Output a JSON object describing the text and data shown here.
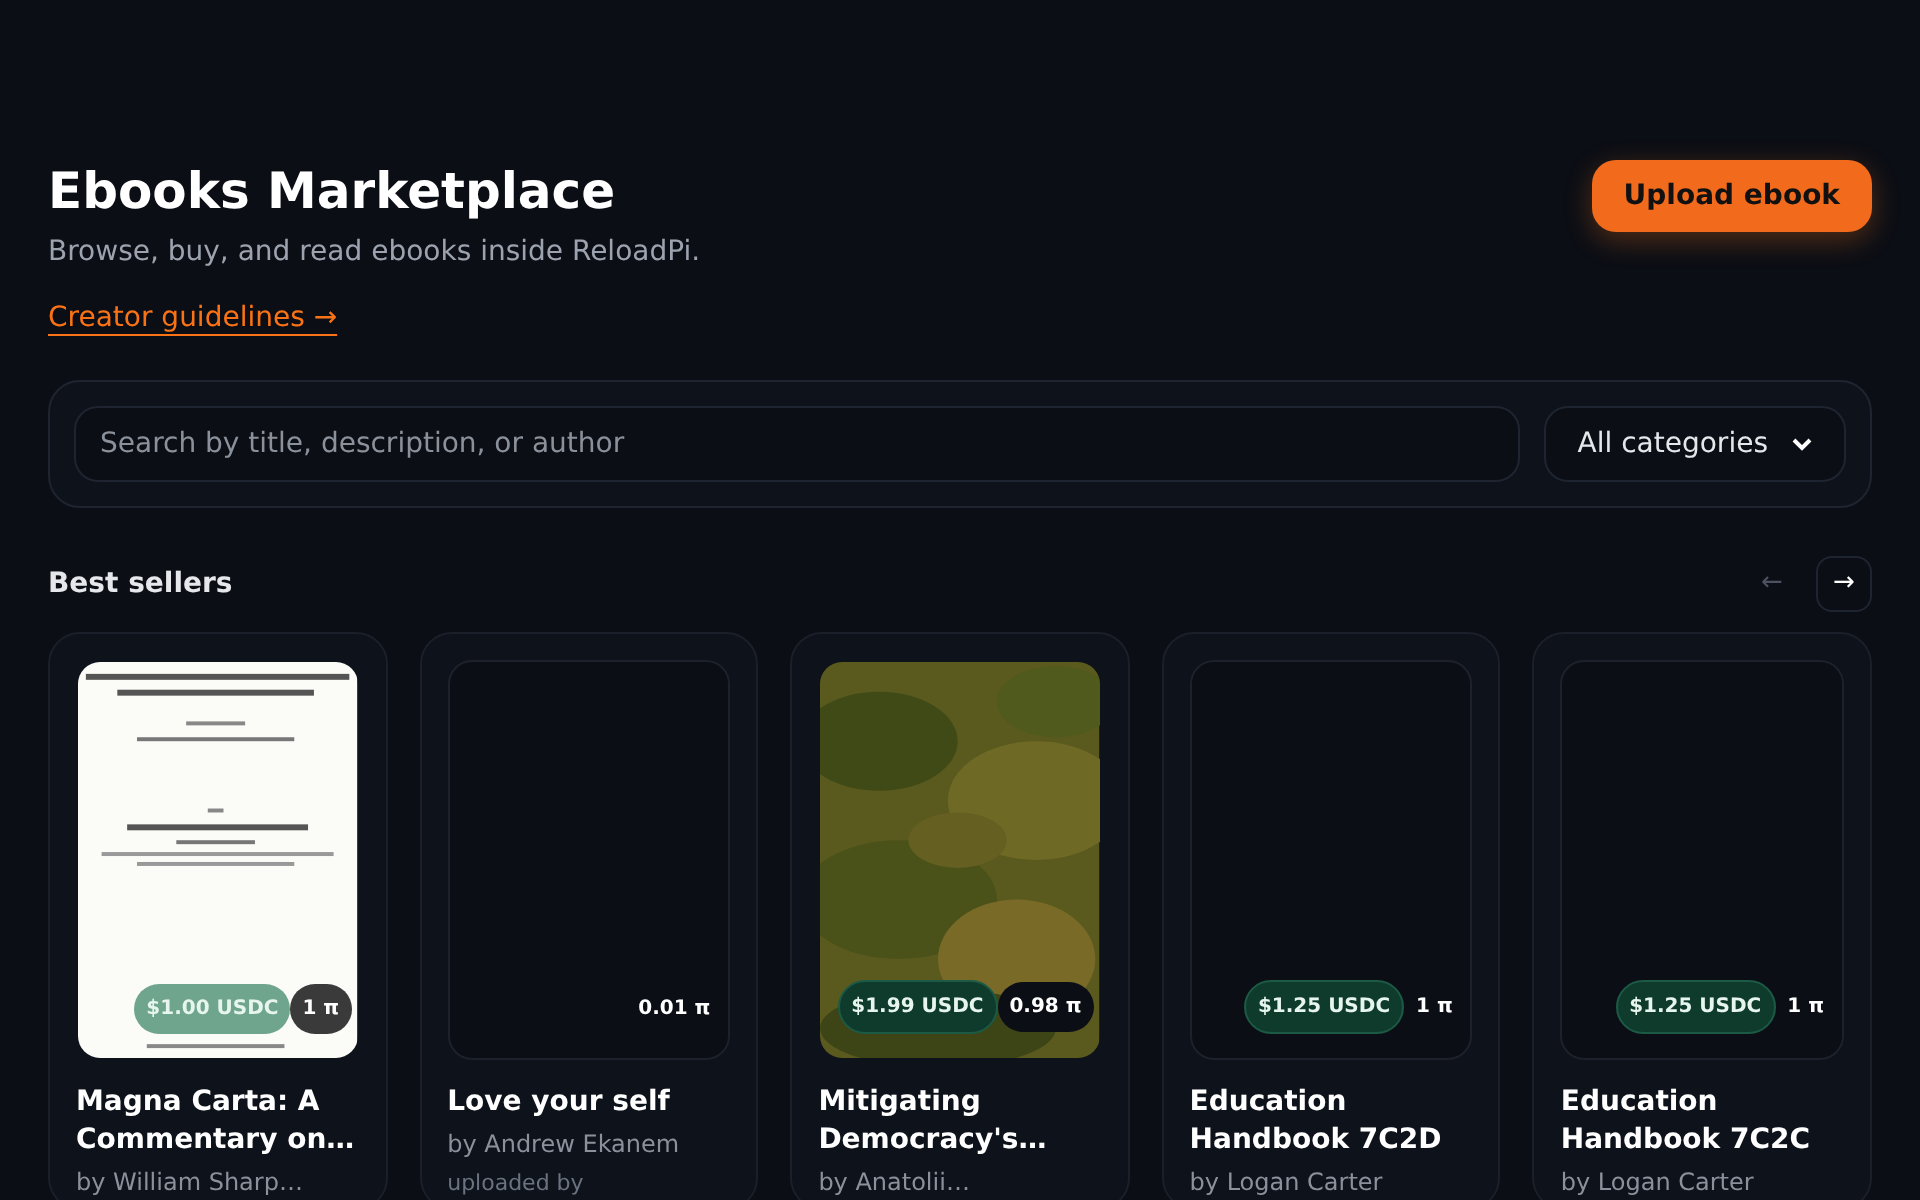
{
  "header": {
    "title": "Ebooks Marketplace",
    "subtitle": "Browse, buy, and read ebooks inside ReloadPi.",
    "link": "Creator guidelines →",
    "upload_button": "Upload ebook"
  },
  "filters": {
    "search_placeholder": "Search by title, description, or author",
    "category": "All categories"
  },
  "section": {
    "title": "Best sellers",
    "prev": "←",
    "next": "→",
    "prev_disabled": true
  },
  "books": [
    {
      "kind": "document",
      "usdc_price": "$1.00 USDC",
      "pi_price": "1 π",
      "title": "Magna Carta: A Commentary on…",
      "author": "by William Sharp…"
    },
    {
      "kind": "blank",
      "pi_price": "0.01 π",
      "title": "Love your self",
      "author": "by Andrew Ekanem",
      "uploader": "uploaded by"
    },
    {
      "usdc_price": "$1.99 USDC",
      "pi_price": "0.98 π",
      "title": "Mitigating Democracy's…",
      "author": "by Anatolii…"
    },
    {
      "kind": "blank",
      "usdc_price": "$1.25 USDC",
      "pi_price": "1 π",
      "title": "Education Handbook 7C2D",
      "author": "by Logan Carter"
    },
    {
      "kind": "blank",
      "usdc_price": "$1.25 USDC",
      "pi_price": "1 π",
      "title": "Education Handbook 7C2C",
      "author": "by Logan Carter"
    }
  ]
}
